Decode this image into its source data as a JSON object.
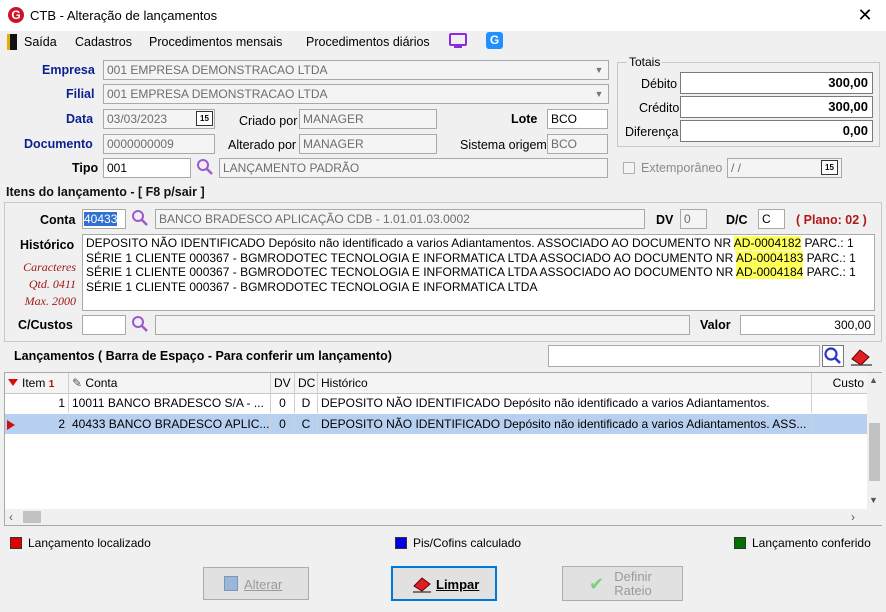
{
  "window": {
    "title": "CTB - Alteração de lançamentos",
    "logo": "G",
    "close": "✕"
  },
  "menu": {
    "items": [
      "Saída",
      "Cadastros",
      "Procedimentos mensais",
      "Procedimentos diários"
    ]
  },
  "header": {
    "empresa_label": "Empresa",
    "empresa_value": "001 EMPRESA DEMONSTRACAO LTDA",
    "filial_label": "Filial",
    "filial_value": "001 EMPRESA DEMONSTRACAO LTDA",
    "data_label": "Data",
    "data_value": "03/03/2023",
    "criado_por_label": "Criado por",
    "criado_por_value": "MANAGER",
    "lote_label": "Lote",
    "lote_value": "BCO",
    "documento_label": "Documento",
    "documento_value": "0000000009",
    "alterado_por_label": "Alterado por",
    "alterado_por_value": "MANAGER",
    "sistema_origem_label": "Sistema origem",
    "sistema_origem_value": "BCO",
    "tipo_label": "Tipo",
    "tipo_code": "001",
    "tipo_desc": "LANÇAMENTO PADRÃO",
    "extemporaneo_label": "Extemporâneo",
    "extemporaneo_date": "/ /",
    "calendar_glyph": "15"
  },
  "totais": {
    "title": "Totais",
    "debito_label": "Débito",
    "debito_value": "300,00",
    "credito_label": "Crédito",
    "credito_value": "300,00",
    "diferenca_label": "Diferença",
    "diferenca_value": "0,00"
  },
  "item": {
    "section_title": "Itens do lançamento - [ F8 p/sair ]",
    "conta_label": "Conta",
    "conta_code": "40433",
    "conta_desc": "BANCO BRADESCO APLICAÇÃO CDB - 1.01.01.03.0002",
    "dv_label": "DV",
    "dv_value": "0",
    "dc_label": "D/C",
    "dc_value": "C",
    "plano": "( Plano: 02 )",
    "historico_label": "Histórico",
    "caracteres_label": "Caracteres",
    "qtd_label": "Qtd. 0411",
    "max_label": "Max. 2000",
    "historico_lines": [
      {
        "pre": "DEPOSITO NÃO IDENTIFICADO Depósito não identificado a varios Adiantamentos. ASSOCIADO AO DOCUMENTO NR ",
        "hl": "AD-0004182",
        "post": " PARC.: 1"
      },
      {
        "pre": "SÉRIE 1 CLIENTE 000367 - BGMRODOTEC TECNOLOGIA E INFORMATICA LTDA ASSOCIADO AO DOCUMENTO NR ",
        "hl": "AD-0004183",
        "post": " PARC.: 1"
      },
      {
        "pre": "SÉRIE 1 CLIENTE 000367 - BGMRODOTEC TECNOLOGIA E INFORMATICA LTDA ASSOCIADO AO DOCUMENTO NR ",
        "hl": "AD-0004184",
        "post": " PARC.: 1"
      },
      {
        "pre": "SÉRIE 1 CLIENTE 000367 - BGMRODOTEC TECNOLOGIA E INFORMATICA LTDA",
        "hl": "",
        "post": ""
      }
    ],
    "ccustos_label": "C/Custos",
    "valor_label": "Valor",
    "valor_value": "300,00"
  },
  "lancamentos": {
    "title": "Lançamentos ( Barra de Espaço - Para conferir um lançamento)",
    "columns": [
      "Item",
      "Conta",
      "DV",
      "DC",
      "Histórico",
      "Custo"
    ],
    "rows": [
      {
        "item": "1",
        "conta": "10011 BANCO BRADESCO S/A - ...",
        "dv": "0",
        "dc": "D",
        "historico": "DEPOSITO NÃO IDENTIFICADO Depósito não identificado a varios Adiantamentos."
      },
      {
        "item": "2",
        "conta": "40433 BANCO BRADESCO APLIC...",
        "dv": "0",
        "dc": "C",
        "historico": "DEPOSITO NÃO IDENTIFICADO Depósito não identificado a varios Adiantamentos. ASS..."
      }
    ]
  },
  "legend": {
    "localizado": "Lançamento localizado",
    "localizado_color": "#e00000",
    "pis": "Pis/Cofins calculado",
    "pis_color": "#0000e0",
    "conferido": "Lançamento conferido",
    "conferido_color": "#007000"
  },
  "buttons": {
    "alterar": "Alterar",
    "limpar": "Limpar",
    "definir_line1": "Definir",
    "definir_line2": "Rateio"
  }
}
